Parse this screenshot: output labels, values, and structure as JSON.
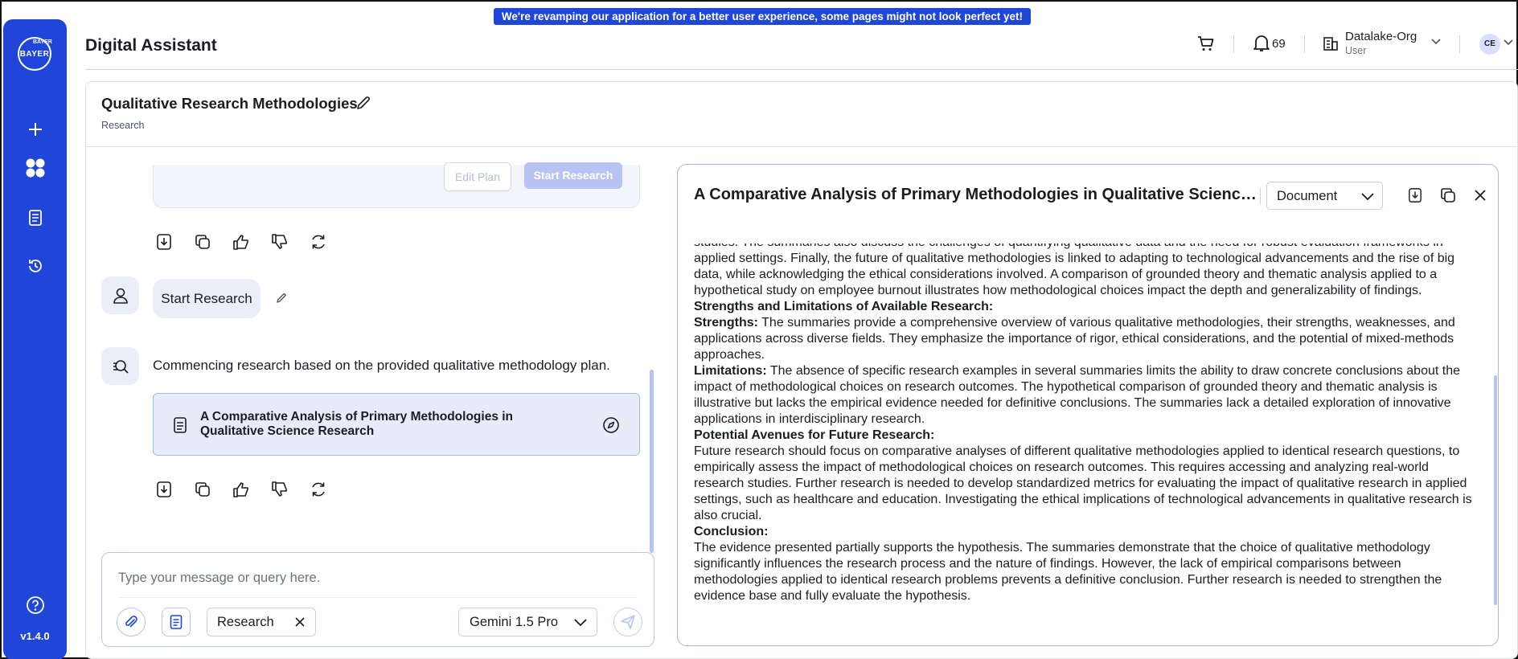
{
  "banner": "We're revamping our application for a better user experience, some pages might not look perfect yet!",
  "sidebar": {
    "logo_text": "BAYER",
    "logo_vertical": "BAYER",
    "version": "v1.4.0",
    "items": [
      {
        "icon": "plus-icon",
        "label": "New"
      },
      {
        "icon": "apps-grid-icon",
        "label": "Apps"
      },
      {
        "icon": "document-icon",
        "label": "Documents"
      },
      {
        "icon": "history-icon",
        "label": "History"
      },
      {
        "icon": "help-icon",
        "label": "Help"
      }
    ]
  },
  "header": {
    "title": "Digital Assistant",
    "notifications_count": "69",
    "org_name": "Datalake-Org",
    "org_role": "User",
    "avatar_initials": "CE"
  },
  "conversation": {
    "title": "Qualitative Research Methodologies",
    "category": "Research"
  },
  "chat": {
    "plan_buttons": {
      "edit": "Edit Plan",
      "start": "Start Research"
    },
    "user_message": "Start Research",
    "bot_message": "Commencing research based on the provided qualitative methodology plan.",
    "doc_card_title": "A Comparative Analysis of Primary Methodologies in Qualitative Science Research"
  },
  "composer": {
    "placeholder": "Type your message or query here.",
    "chip_label": "Research",
    "model": "Gemini 1.5 Pro"
  },
  "doc_panel": {
    "title": "A Comparative Analysis of Primary Methodologies in Qualitative Science Research",
    "view_mode": "Document",
    "intro": "studies. The summaries also discuss the challenges of quantifying qualitative data and the need for robust evaluation frameworks in applied settings. Finally, the future of qualitative methodologies is linked to adapting to technological advancements and the rise of big data, while acknowledging the ethical considerations involved. A comparison of grounded theory and thematic analysis applied to a hypothetical study on employee burnout illustrates how methodological choices impact the depth and generalizability of findings.",
    "h_strengths": "Strengths and Limitations of Available Research:",
    "strengths_label": "Strengths:",
    "strengths_text": " The summaries provide a comprehensive overview of various qualitative methodologies, their strengths, weaknesses, and applications across diverse fields. They emphasize the importance of rigor, ethical considerations, and the potential of mixed-methods approaches.",
    "limitations_label": "Limitations:",
    "limitations_text": " The absence of specific research examples in several summaries limits the ability to draw concrete conclusions about the impact of methodological choices on research outcomes. The hypothetical comparison of grounded theory and thematic analysis is illustrative but lacks the empirical evidence needed for definitive conclusions. The summaries lack a detailed exploration of innovative applications in interdisciplinary research.",
    "h_future": "Potential Avenues for Future Research:",
    "future_text": "Future research should focus on comparative analyses of different qualitative methodologies applied to identical research questions, to empirically assess the impact of methodological choices on research outcomes. This requires accessing and analyzing real-world research studies. Further research is needed to develop standardized metrics for evaluating the impact of qualitative research in applied settings, such as healthcare and education. Investigating the ethical implications of technological advancements in qualitative research is also crucial.",
    "h_conclusion": "Conclusion:",
    "conclusion_text": "The evidence presented partially supports the hypothesis. The summaries demonstrate that the choice of qualitative methodology significantly influences the research process and the nature of findings. However, the lack of empirical comparisons between methodologies applied to identical research problems prevents a definitive conclusion. Further research is needed to strengthen the evidence base and fully evaluate the hypothesis."
  }
}
